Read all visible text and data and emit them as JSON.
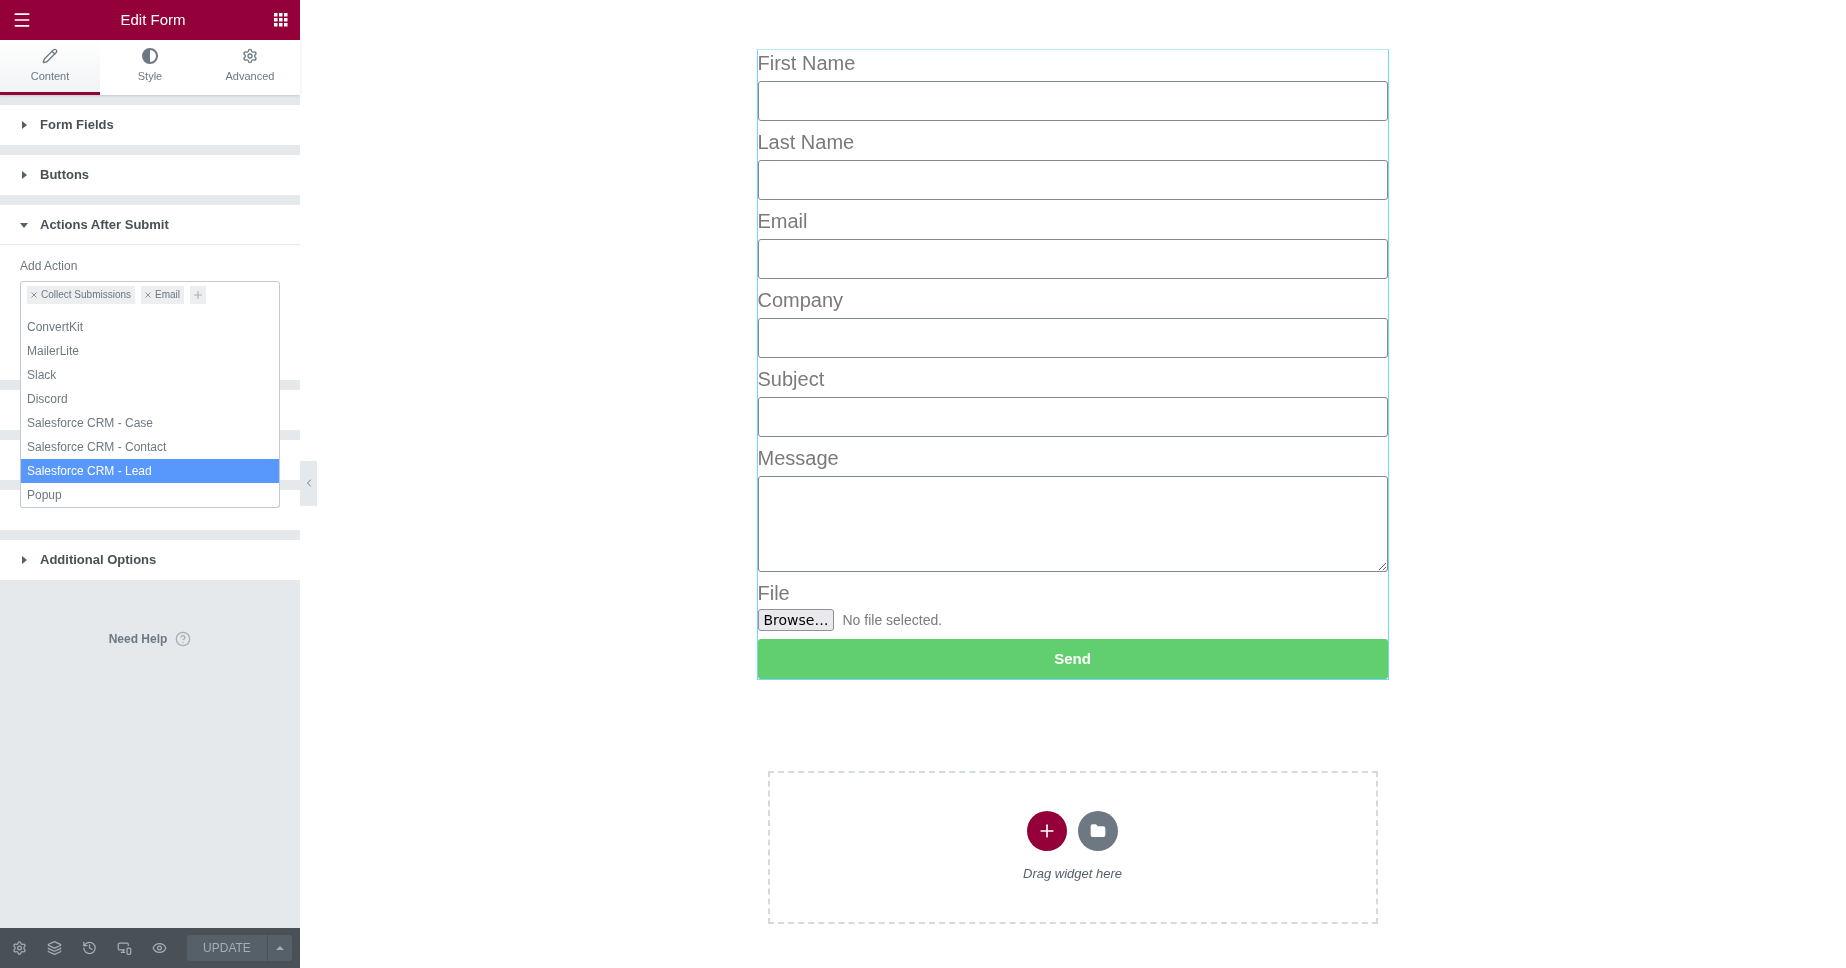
{
  "panel": {
    "title": "Edit Form",
    "tabs": [
      {
        "label": "Content",
        "selected": true
      },
      {
        "label": "Style",
        "selected": false
      },
      {
        "label": "Advanced",
        "selected": false
      }
    ],
    "sections": [
      {
        "title": "Form Fields",
        "expanded": false
      },
      {
        "title": "Buttons",
        "expanded": false
      },
      {
        "title": "Actions After Submit",
        "expanded": true
      },
      {
        "title": "Additional Options",
        "expanded": false
      }
    ],
    "add_action": {
      "label": "Add Action",
      "tags": [
        "Collect Submissions",
        "Email"
      ],
      "options": [
        {
          "label": "ConvertKit",
          "selected": false
        },
        {
          "label": "MailerLite",
          "selected": false
        },
        {
          "label": "Slack",
          "selected": false
        },
        {
          "label": "Discord",
          "selected": false
        },
        {
          "label": "Salesforce CRM - Case",
          "selected": false
        },
        {
          "label": "Salesforce CRM - Contact",
          "selected": false
        },
        {
          "label": "Salesforce CRM - Lead",
          "selected": true
        },
        {
          "label": "Popup",
          "selected": false
        }
      ]
    },
    "help": "Need Help",
    "footer": {
      "update": "UPDATE"
    }
  },
  "form": {
    "fields": [
      {
        "kind": "text",
        "label": "First Name"
      },
      {
        "kind": "text",
        "label": "Last Name"
      },
      {
        "kind": "text",
        "label": "Email"
      },
      {
        "kind": "text",
        "label": "Company"
      },
      {
        "kind": "text",
        "label": "Subject"
      },
      {
        "kind": "textarea",
        "label": "Message"
      },
      {
        "kind": "file",
        "label": "File",
        "button": "Browse…",
        "note": "No file selected."
      }
    ],
    "submit": "Send"
  },
  "dropzone": {
    "text": "Drag widget here"
  }
}
